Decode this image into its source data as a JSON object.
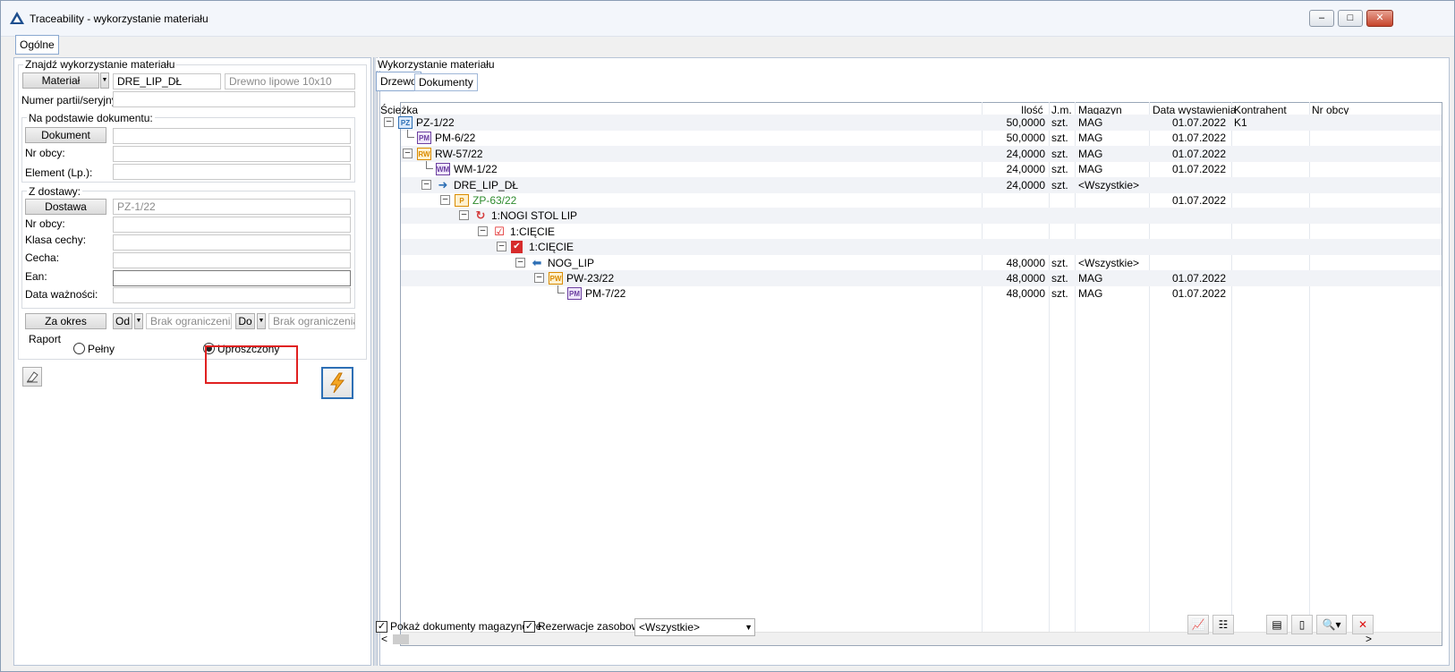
{
  "window": {
    "title": "Traceability - wykorzystanie materiału",
    "minimize": "–",
    "maximize": "□",
    "close": "✕"
  },
  "tabs": [
    "Ogólne"
  ],
  "left": {
    "find_group": "Znajdź wykorzystanie materiału",
    "material_button": "Materiał",
    "material_code": "DRE_LIP_DŁ",
    "material_name": "Drewno lipowe 10x10",
    "batch_label": "Numer partii/seryjny:",
    "batch_value": "",
    "doc_group": "Na podstawie dokumentu:",
    "doc_button": "Dokument",
    "doc_value": "",
    "doc_nr_label": "Nr obcy:",
    "doc_nr_value": "",
    "element_label": "Element (Lp.):",
    "element_value": "",
    "supply_group": "Z dostawy:",
    "supply_button": "Dostawa",
    "supply_value": "PZ-1/22",
    "supply_nr_label": "Nr obcy:",
    "class_label": "Klasa cechy:",
    "feature_label": "Cecha:",
    "ean_label": "Ean:",
    "expiry_label": "Data ważności:",
    "period_button": "Za okres",
    "from_button": "Od",
    "from_value": "Brak ograniczenia",
    "to_button": "Do",
    "to_value": "Brak ograniczenia",
    "report_group": "Raport",
    "report_full": "Pełny",
    "report_simple": "Uproszczony",
    "report_selected": "Uproszczony"
  },
  "right": {
    "group_title": "Wykorzystanie materiału",
    "subtabs": [
      "Drzewo",
      "Dokumenty"
    ],
    "active_subtab": "Drzewo",
    "columns": [
      "Ścieżka",
      "Ilość",
      "J.m.",
      "Magazyn",
      "Data wystawienia",
      "Kontrahent",
      "Nr obcy"
    ],
    "rows": [
      {
        "name": "PZ-1/22",
        "icon": "PZ",
        "qty": "50,0000",
        "unit": "szt.",
        "warehouse": "MAG",
        "date": "01.07.2022",
        "contractor": "K1",
        "ext": ""
      },
      {
        "name": "PM-6/22",
        "icon": "PM",
        "qty": "50,0000",
        "unit": "szt.",
        "warehouse": "MAG",
        "date": "01.07.2022",
        "contractor": "",
        "ext": ""
      },
      {
        "name": "RW-57/22",
        "icon": "RW",
        "qty": "24,0000",
        "unit": "szt.",
        "warehouse": "MAG",
        "date": "01.07.2022",
        "contractor": "",
        "ext": ""
      },
      {
        "name": "WM-1/22",
        "icon": "WM",
        "qty": "24,0000",
        "unit": "szt.",
        "warehouse": "MAG",
        "date": "01.07.2022",
        "contractor": "",
        "ext": ""
      },
      {
        "name": "DRE_LIP_DŁ",
        "icon": "arrow-right",
        "qty": "24,0000",
        "unit": "szt.",
        "warehouse": "<Wszystkie>",
        "date": "",
        "contractor": "",
        "ext": ""
      },
      {
        "name": "ZP-63/22",
        "icon": "P",
        "qty": "",
        "unit": "",
        "warehouse": "",
        "date": "01.07.2022",
        "contractor": "",
        "ext": ""
      },
      {
        "name": "1:NOGI STOL LIP",
        "icon": "cycle",
        "qty": "",
        "unit": "",
        "warehouse": "",
        "date": "",
        "contractor": "",
        "ext": ""
      },
      {
        "name": "1:CIĘCIE",
        "icon": "check-outline",
        "qty": "",
        "unit": "",
        "warehouse": "",
        "date": "",
        "contractor": "",
        "ext": ""
      },
      {
        "name": "1:CIĘCIE",
        "icon": "check-filled",
        "qty": "",
        "unit": "",
        "warehouse": "",
        "date": "",
        "contractor": "",
        "ext": ""
      },
      {
        "name": "NOG_LIP",
        "icon": "arrow-left",
        "qty": "48,0000",
        "unit": "szt.",
        "warehouse": "<Wszystkie>",
        "date": "",
        "contractor": "",
        "ext": ""
      },
      {
        "name": "PW-23/22",
        "icon": "PW",
        "qty": "48,0000",
        "unit": "szt.",
        "warehouse": "MAG",
        "date": "01.07.2022",
        "contractor": "",
        "ext": ""
      },
      {
        "name": "PM-7/22",
        "icon": "PM",
        "qty": "48,0000",
        "unit": "szt.",
        "warehouse": "MAG",
        "date": "01.07.2022",
        "contractor": "",
        "ext": ""
      }
    ],
    "show_docs_label": "Pokaż dokumenty magazynowe",
    "show_docs_checked": true,
    "reservations_label": "Rezerwacje zasobowe",
    "reservations_checked": true,
    "filter_value": "<Wszystkie>",
    "scroll_left": "<",
    "scroll_right": ">"
  },
  "colors": {
    "accent": "#2d6fb5",
    "highlight": "#e02020",
    "green_text": "#2e8b2e"
  }
}
